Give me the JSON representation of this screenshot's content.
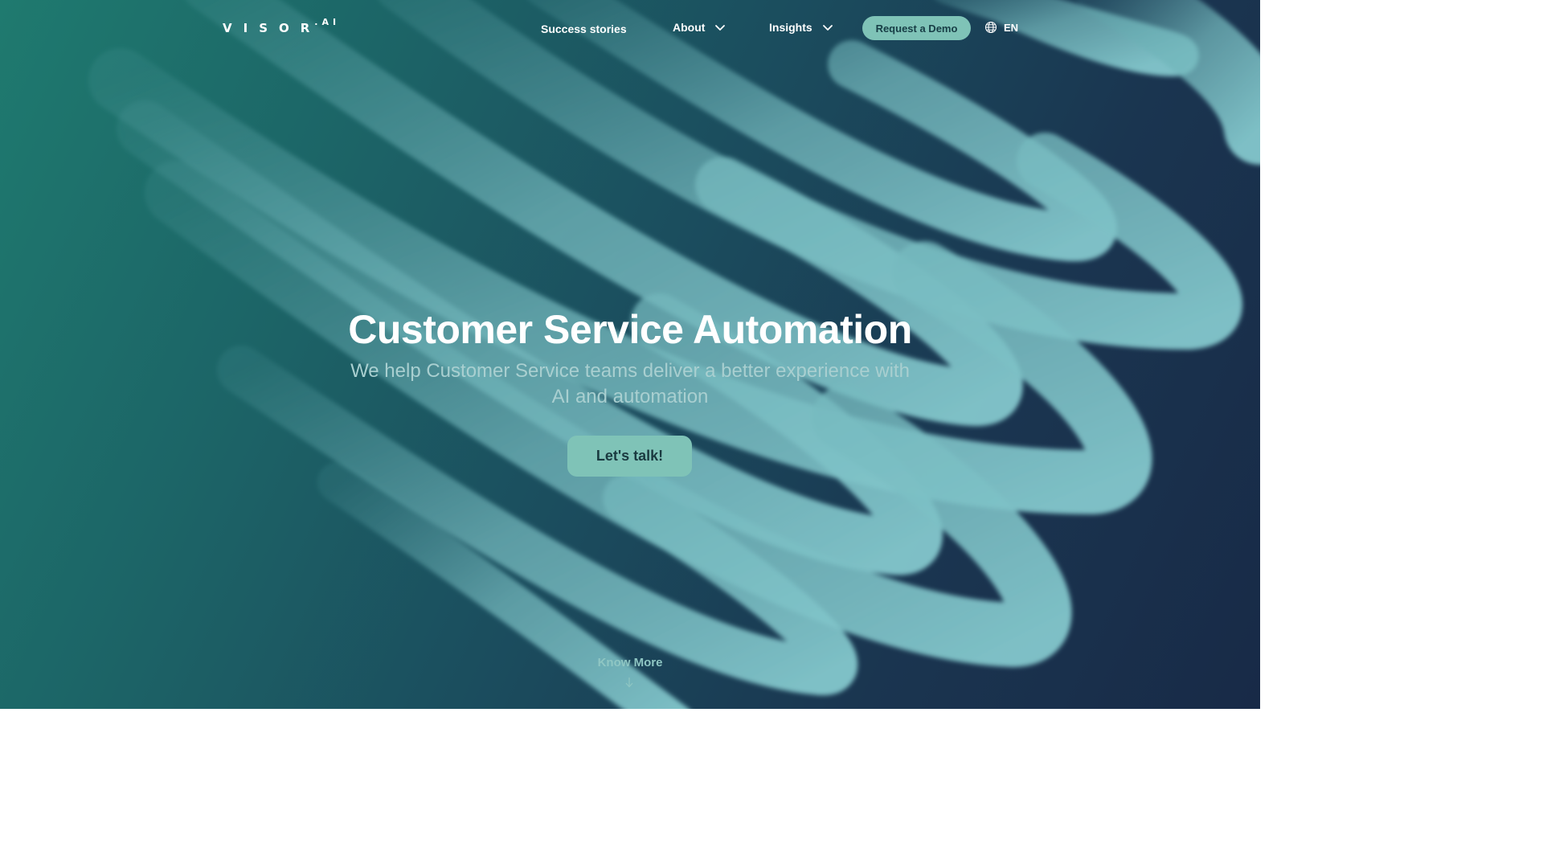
{
  "header": {
    "logo_text": "VISOR",
    "logo_suffix": ".AI",
    "nav": {
      "success_stories": "Success stories",
      "about": "About",
      "insights": "Insights"
    },
    "demo_button": "Request a Demo",
    "language": "EN"
  },
  "hero": {
    "title": "Customer Service Automation",
    "subtitle": "We help Customer Service teams deliver a better experience with AI and automation",
    "cta": "Let's talk!"
  },
  "footer_link": {
    "know_more": "Know More"
  },
  "icons": {
    "about_dropdown": "chevron-down-icon",
    "insights_dropdown": "chevron-down-icon",
    "language": "globe-icon",
    "scroll": "arrow-down-icon"
  },
  "colors": {
    "accent": "#7fc3b7",
    "background_start": "#1f7a6f",
    "background_end": "#182a47",
    "subtitle": "#a9cfd0"
  }
}
